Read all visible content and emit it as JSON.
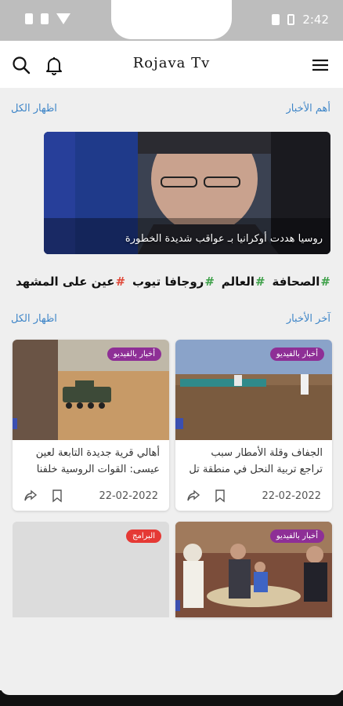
{
  "status": {
    "time": "2:42"
  },
  "app": {
    "title": "Rojava Tv"
  },
  "top_news": {
    "header": "أهم الأخبار",
    "show_all": "اظهار الكل"
  },
  "featured": {
    "caption": "روسيا هددت أوكرانيا بـ عواقب شديدة الخطورة"
  },
  "tags": [
    {
      "hash": "#",
      "label": "الصحافة",
      "hash_color": "#3fa14a"
    },
    {
      "hash": "#",
      "label": "العالم",
      "hash_color": "#3fa14a"
    },
    {
      "hash": "#",
      "label": "روجافا تيوب",
      "hash_color": "#3fa14a"
    },
    {
      "hash": "#",
      "label": "عين على المشهد",
      "hash_color": "#e04a3a"
    }
  ],
  "latest_news": {
    "header": "آخر الأخبار",
    "show_all": "اظهار الكل"
  },
  "cards": [
    {
      "badge": "أخبار بالفيديو",
      "badge_color": "#8e2f96",
      "text": "الجفاف وقلة الأمطار سبب تراجع تربية النحل في منطقة تل تمر",
      "date": "22-02-2022"
    },
    {
      "badge": "أخبار بالفيديو",
      "badge_color": "#8e2f96",
      "text": "أهالي قرية جديدة التابعة لعين عيسى: القوات الروسية خلفنا وبث...",
      "date": "22-02-2022"
    },
    {
      "badge": "أخبار بالفيديو",
      "badge_color": "#8e2f96"
    },
    {
      "badge": "البرامج",
      "badge_color": "#e53935"
    }
  ],
  "colors": {
    "accent": "#3f86c8"
  }
}
